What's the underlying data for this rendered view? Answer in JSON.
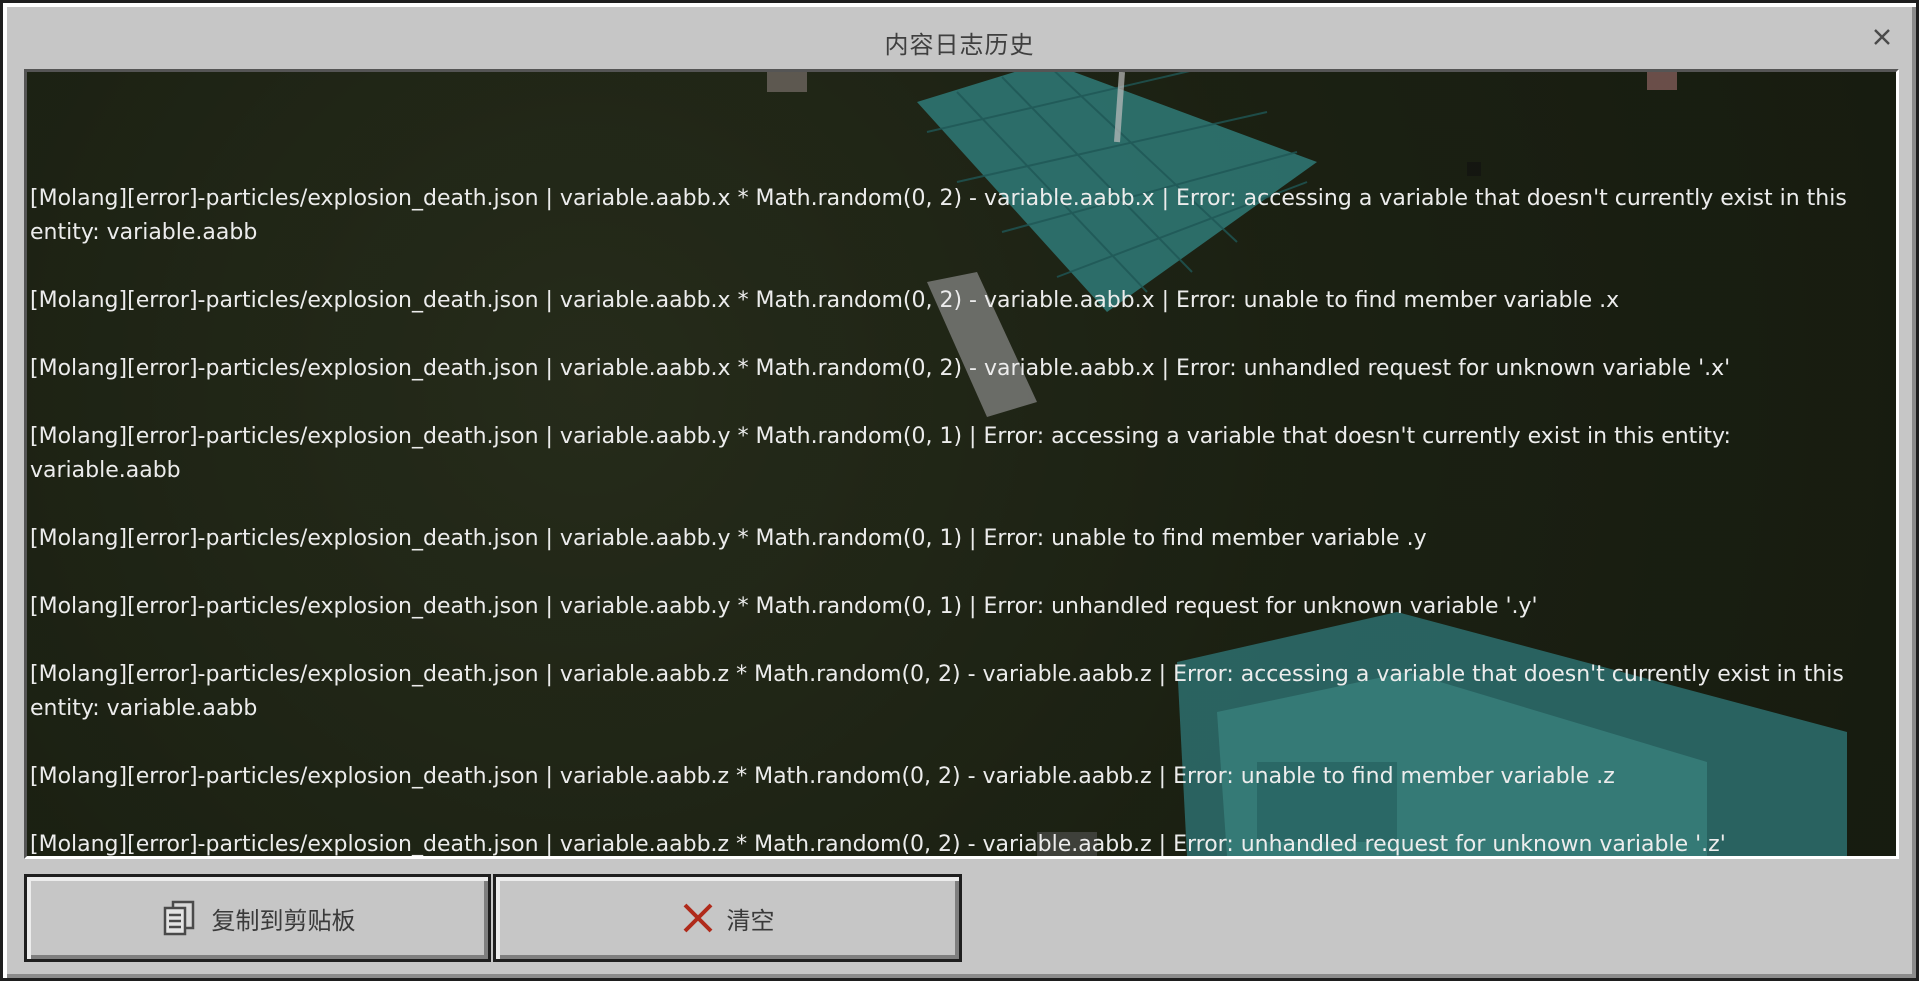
{
  "window": {
    "title": "内容日志历史"
  },
  "log": {
    "entries": [
      "[Molang][error]-particles/explosion_death.json | variable.aabb.x * Math.random(0, 2) - variable.aabb.x | Error: accessing a variable that doesn't currently exist in this entity: variable.aabb",
      "[Molang][error]-particles/explosion_death.json | variable.aabb.x * Math.random(0, 2) - variable.aabb.x | Error: unable to find member variable .x",
      "[Molang][error]-particles/explosion_death.json | variable.aabb.x * Math.random(0, 2) - variable.aabb.x | Error: unhandled request for unknown variable '.x'",
      "[Molang][error]-particles/explosion_death.json | variable.aabb.y * Math.random(0, 1) | Error: accessing a variable that doesn't currently exist in this entity: variable.aabb",
      "[Molang][error]-particles/explosion_death.json | variable.aabb.y * Math.random(0, 1) | Error: unable to find member variable .y",
      "[Molang][error]-particles/explosion_death.json | variable.aabb.y * Math.random(0, 1) | Error: unhandled request for unknown variable '.y'",
      "[Molang][error]-particles/explosion_death.json | variable.aabb.z * Math.random(0, 2) - variable.aabb.z | Error: accessing a variable that doesn't currently exist in this entity: variable.aabb",
      "[Molang][error]-particles/explosion_death.json | variable.aabb.z * Math.random(0, 2) - variable.aabb.z | Error: unable to find member variable .z",
      "[Molang][error]-particles/explosion_death.json | variable.aabb.z * Math.random(0, 2) - variable.aabb.z | Error: unhandled request for unknown variable '.z'"
    ]
  },
  "buttons": {
    "copy_label": "复制到剪贴板",
    "clear_label": "清空"
  },
  "icons": {
    "close": "close-icon",
    "copy": "clipboard-icon",
    "clear": "x-icon"
  },
  "colors": {
    "panel_bg": "#c6c6c6",
    "log_text": "#ececec",
    "clear_icon": "#b02a1a"
  }
}
